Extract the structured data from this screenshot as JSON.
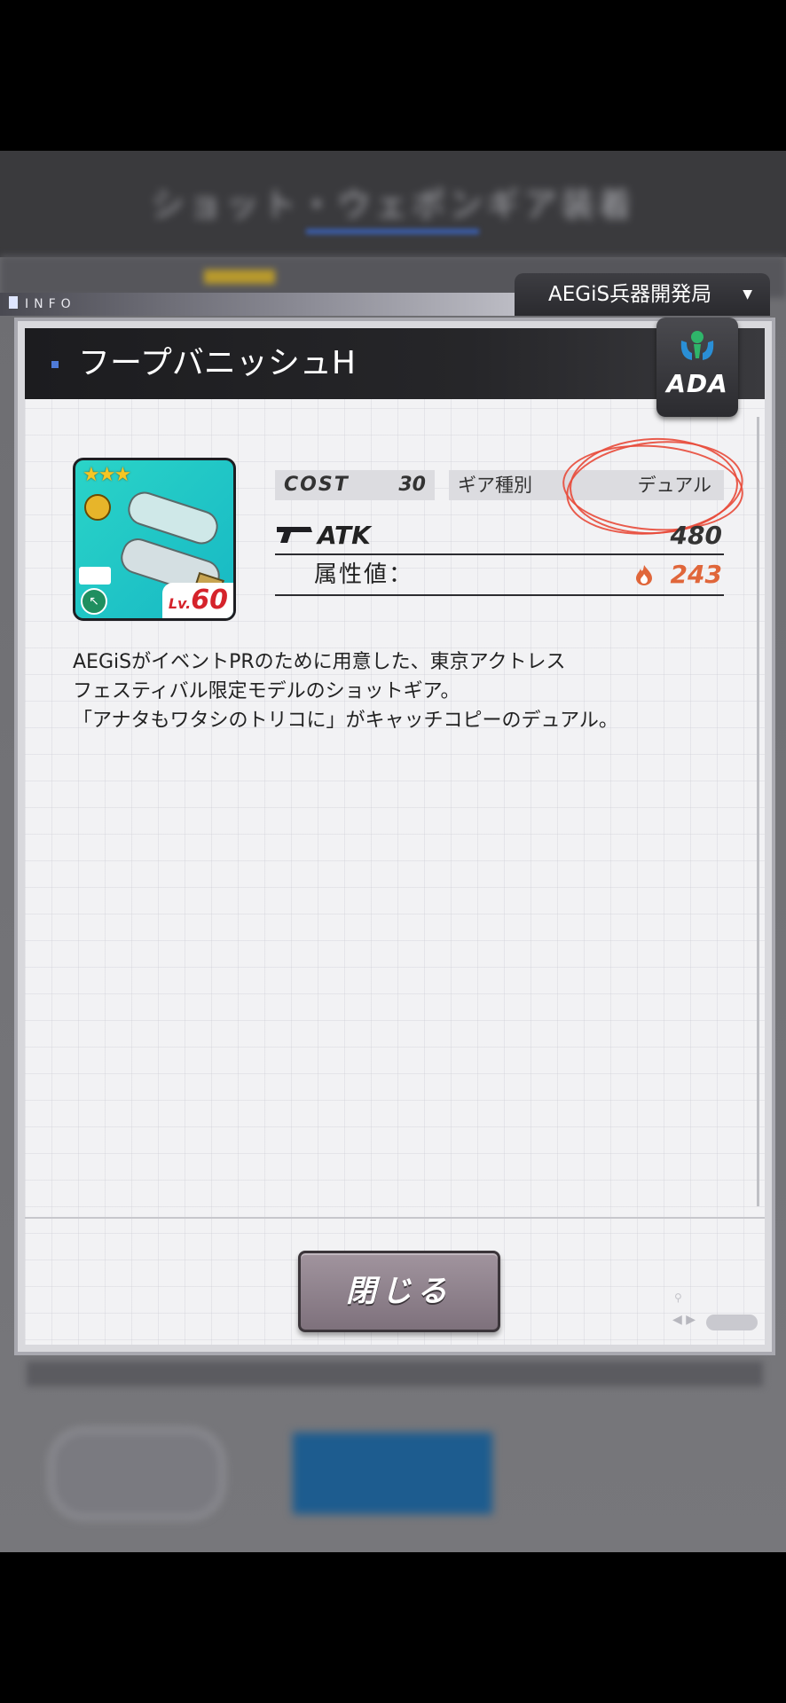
{
  "background": {
    "title": "ショット・ウェポンギア装着"
  },
  "info_tab": {
    "label": "INFO"
  },
  "department": {
    "label": "AEGiS兵器開発局",
    "dropdown_glyph": "▼"
  },
  "item": {
    "name": "フープバニッシュH",
    "logo_text": "ADA",
    "rarity_stars": "★★★",
    "level_prefix": "Lv.",
    "level": "60",
    "cost_label": "COST",
    "cost_value": "30",
    "gear_type_label": "ギア種別",
    "gear_type_value": "デュアル",
    "atk_label": "ATK",
    "atk_value": "480",
    "attribute_label": "属性値：",
    "attribute_value": "243"
  },
  "description": [
    "AEGiSがイベントPRのために用意した、東京アクトレス",
    "フェスティバル限定モデルのショットギア。",
    "「アナタもワタシのトリコに」がキャッチコピーのデュアル。"
  ],
  "buttons": {
    "close_label": "閉じる"
  },
  "colors": {
    "accent_blue": "#4f7bd8",
    "level_red": "#d5232b",
    "attribute_orange": "#e0663a",
    "annotation_red": "#e84a3a"
  },
  "icons": {
    "logo": "ada-logo-icon",
    "gun": "gun-icon",
    "flame": "flame-attribute-icon",
    "lock": "lock-icon"
  }
}
